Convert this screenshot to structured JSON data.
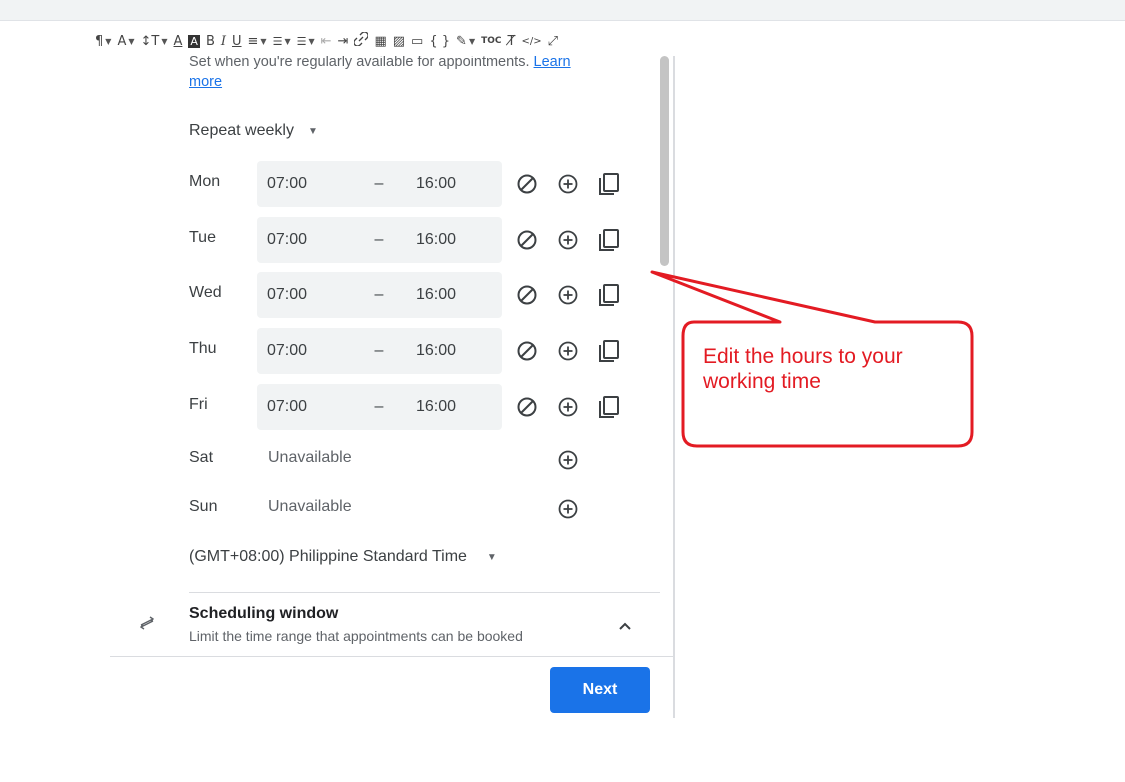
{
  "toolbar": {
    "items": [
      {
        "name": "paragraph-format-icon",
        "glyph": "¶",
        "caret": true
      },
      {
        "name": "font-family-icon",
        "glyph": "A",
        "caret": true
      },
      {
        "name": "font-size-icon",
        "glyph": "↕T",
        "caret": true
      },
      {
        "name": "text-color-icon",
        "glyph": "A",
        "caret": false
      },
      {
        "name": "background-color-icon",
        "glyph": "A",
        "caret": false
      },
      {
        "name": "bold-icon",
        "glyph": "B",
        "caret": false
      },
      {
        "name": "italic-icon",
        "glyph": "I",
        "caret": false
      },
      {
        "name": "underline-icon",
        "glyph": "U",
        "caret": false
      },
      {
        "name": "align-icon",
        "glyph": "≡",
        "caret": true
      },
      {
        "name": "ordered-list-icon",
        "glyph": "☰",
        "caret": true
      },
      {
        "name": "unordered-list-icon",
        "glyph": "☰",
        "caret": true
      },
      {
        "name": "outdent-icon",
        "glyph": "⇤",
        "caret": false
      },
      {
        "name": "indent-icon",
        "glyph": "⇥",
        "caret": false
      },
      {
        "name": "link-icon",
        "glyph": "🔗",
        "caret": false
      },
      {
        "name": "table-icon",
        "glyph": "▦",
        "caret": false
      },
      {
        "name": "image-icon",
        "glyph": "▨",
        "caret": false
      },
      {
        "name": "video-icon",
        "glyph": "▭",
        "caret": false
      },
      {
        "name": "code-block-icon",
        "glyph": "{ }",
        "caret": false
      },
      {
        "name": "attachment-icon",
        "glyph": "✎",
        "caret": true
      },
      {
        "name": "toc-icon",
        "glyph": "TOC",
        "caret": false
      },
      {
        "name": "clear-format-icon",
        "glyph": "T̸",
        "caret": false
      },
      {
        "name": "source-code-icon",
        "glyph": "</>",
        "caret": false
      },
      {
        "name": "fullscreen-icon",
        "glyph": "⤢",
        "caret": false
      }
    ]
  },
  "availability": {
    "description_text": "Set when you're regularly available for appointments. ",
    "learn_more": "Learn",
    "learn_more_2": "more",
    "repeat_label": "Repeat weekly",
    "days": [
      {
        "label": "Mon",
        "start": "07:00",
        "dash": "–",
        "end": "16:00"
      },
      {
        "label": "Tue",
        "start": "07:00",
        "dash": "–",
        "end": "16:00"
      },
      {
        "label": "Wed",
        "start": "07:00",
        "dash": "–",
        "end": "16:00"
      },
      {
        "label": "Thu",
        "start": "07:00",
        "dash": "–",
        "end": "16:00"
      },
      {
        "label": "Fri",
        "start": "07:00",
        "dash": "–",
        "end": "16:00"
      },
      {
        "label": "Sat",
        "unavailable": "Unavailable"
      },
      {
        "label": "Sun",
        "unavailable": "Unavailable"
      }
    ],
    "timezone": "(GMT+08:00) Philippine Standard Time"
  },
  "scheduling": {
    "title": "Scheduling window",
    "subtitle": "Limit the time range that appointments can be booked"
  },
  "footer": {
    "next_label": "Next"
  },
  "annotation": {
    "callout_text": "Edit the hours to your working time",
    "color": "#e31b23"
  },
  "colors": {
    "accent": "#1a73e8",
    "field_bg": "#f1f3f4"
  }
}
